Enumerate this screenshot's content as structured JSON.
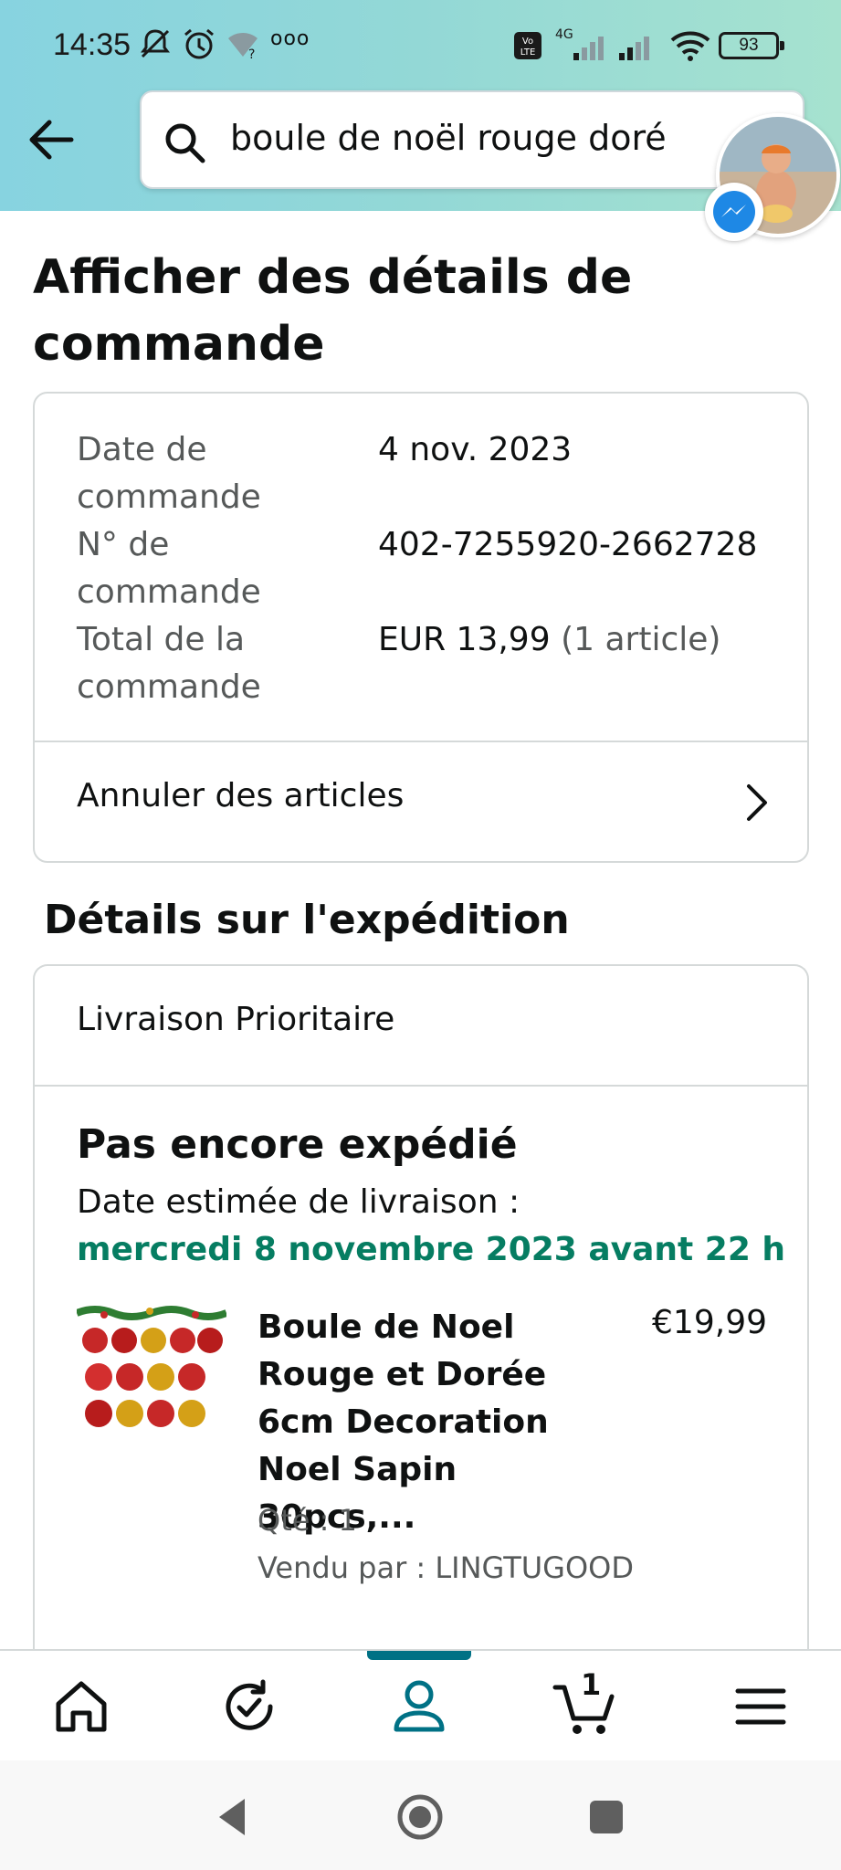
{
  "status_bar": {
    "time": "14:35",
    "battery": "93",
    "network": "4G"
  },
  "search": {
    "query": "boule de noël rouge doré"
  },
  "page_title": "Afficher des détails de commande",
  "order_summary": {
    "rows": [
      {
        "label": "Date de commande",
        "value": "4 nov. 2023",
        "extra": ""
      },
      {
        "label": "N° de commande",
        "value": "402-7255920-2662728",
        "extra": ""
      },
      {
        "label": "Total de la commande",
        "value": "EUR 13,99",
        "extra": " (1 article)"
      }
    ],
    "cancel_label": "Annuler des articles"
  },
  "shipping": {
    "section_title": "Détails sur l'expédition",
    "type": "Livraison Prioritaire",
    "status": "Pas encore expédié",
    "estimate_label": "Date estimée de livraison :",
    "estimate_date": "mercredi 8 novembre 2023 avant 22 h"
  },
  "product": {
    "title": "Boule de Noel Rouge et Dorée 6cm Decoration Noel Sapin 30pcs,...",
    "price": "€19,99",
    "qty": "Qté : 1",
    "seller": "Vendu par : LINGTUGOOD"
  },
  "bottom_nav": {
    "items": [
      "home-icon",
      "history-icon",
      "account-icon",
      "cart-icon",
      "menu-icon"
    ],
    "cart_count": "1",
    "active": "account"
  },
  "colors": {
    "accent": "#007185",
    "delivery_green": "#067d62",
    "header_gradient_start": "#87d3e0",
    "header_gradient_end": "#a6e2cf"
  }
}
